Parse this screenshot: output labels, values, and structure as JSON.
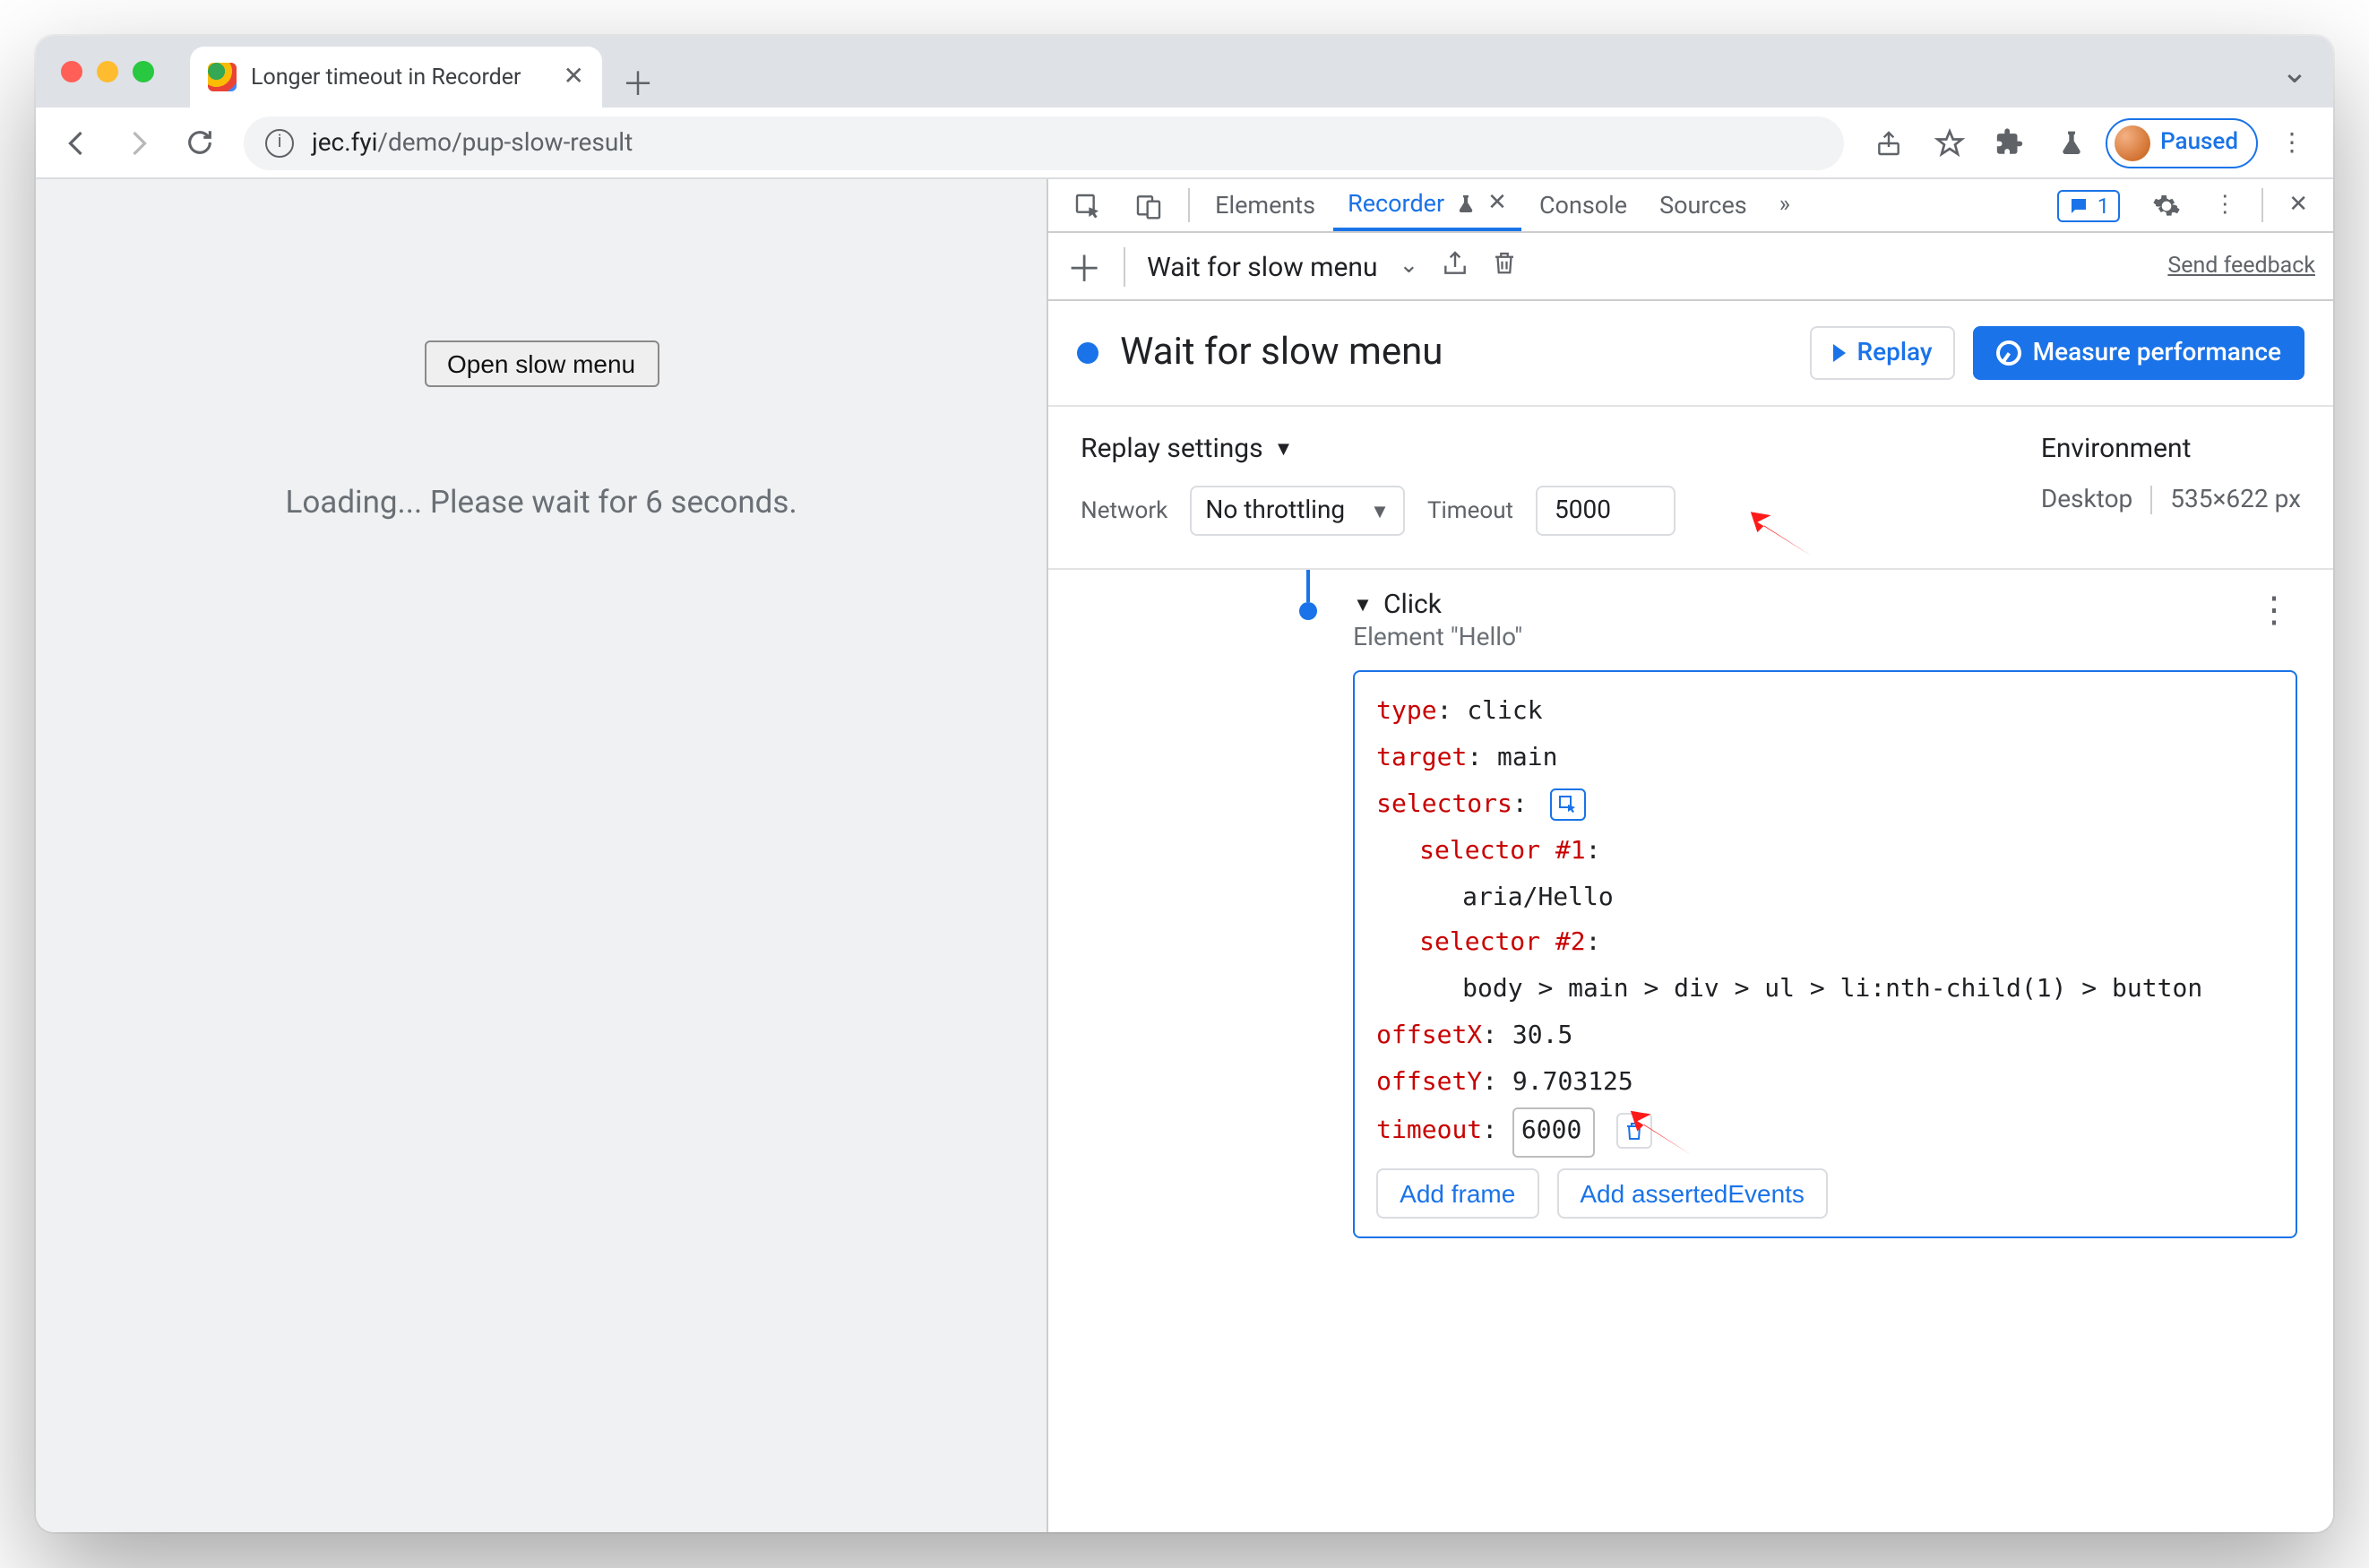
{
  "browser": {
    "tab_title": "Longer timeout in Recorder",
    "url_host": "jec.fyi",
    "url_path": "/demo/pup-slow-result",
    "profile_label": "Paused"
  },
  "page": {
    "button_label": "Open slow menu",
    "loading_text": "Loading... Please wait for 6 seconds."
  },
  "devtools": {
    "tabs": {
      "elements": "Elements",
      "recorder": "Recorder",
      "console": "Console",
      "sources": "Sources"
    },
    "issue_count": "1",
    "subbar": {
      "recording_name": "Wait for slow menu",
      "feedback": "Send feedback"
    },
    "header": {
      "title": "Wait for slow menu",
      "replay": "Replay",
      "measure": "Measure performance"
    },
    "settings": {
      "title": "Replay settings",
      "network_label": "Network",
      "network_value": "No throttling",
      "timeout_label": "Timeout",
      "timeout_value": "5000",
      "env_title": "Environment",
      "env_device": "Desktop",
      "env_size": "535×622 px"
    },
    "step": {
      "name": "Click",
      "sub": "Element \"Hello\"",
      "props": {
        "type_k": "type",
        "type_v": "click",
        "target_k": "target",
        "target_v": "main",
        "selectors_k": "selectors",
        "sel1_k": "selector #1",
        "sel1_v": "aria/Hello",
        "sel2_k": "selector #2",
        "sel2_v": "body > main > div > ul > li:nth-child(1) > button",
        "offx_k": "offsetX",
        "offx_v": "30.5",
        "offy_k": "offsetY",
        "offy_v": "9.703125",
        "timeout_k": "timeout",
        "timeout_v": "6000",
        "add_frame": "Add frame",
        "add_asserted": "Add assertedEvents"
      }
    }
  }
}
